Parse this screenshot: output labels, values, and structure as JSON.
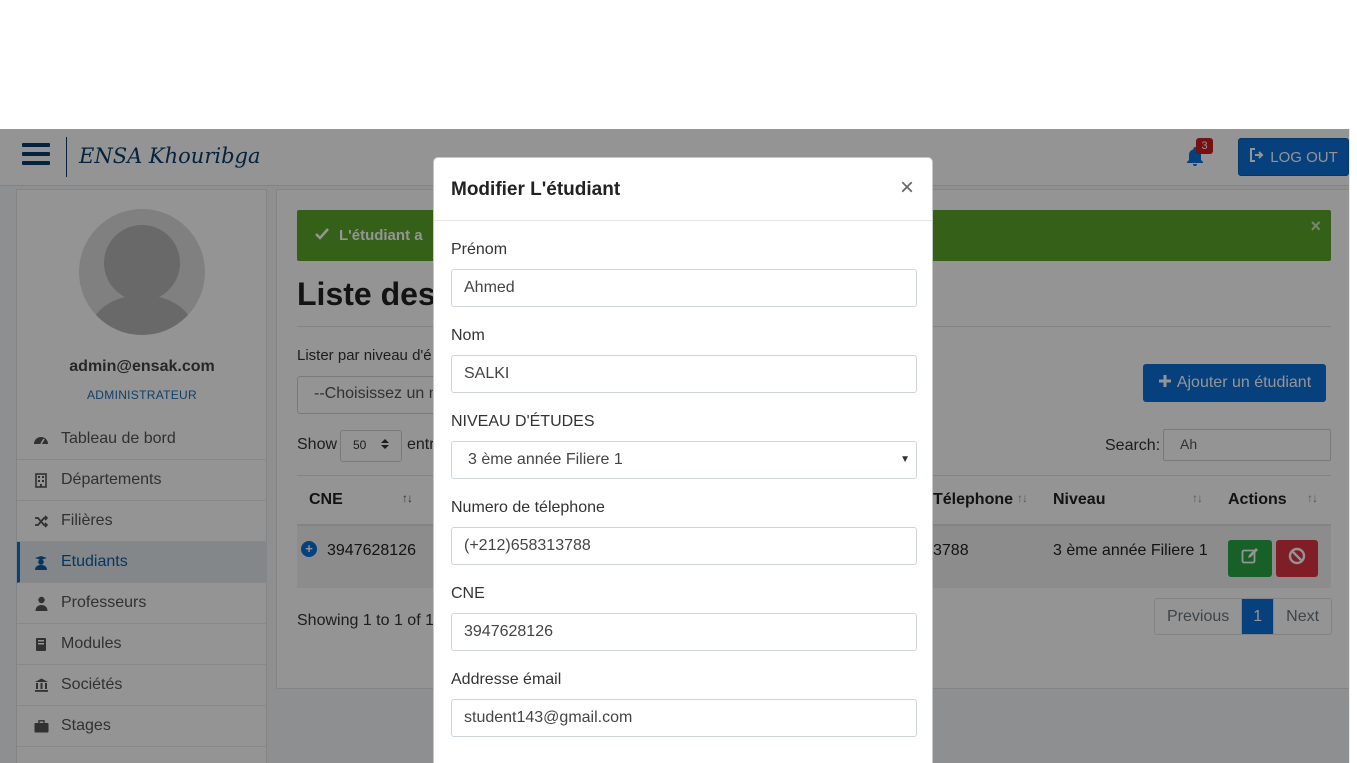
{
  "navbar": {
    "brand": "ENSA Khouribga",
    "notification_count": "3",
    "logout_label": "LOG OUT"
  },
  "sidebar": {
    "user_email": "admin@ensak.com",
    "user_role": "ADMINISTRATEUR",
    "items": [
      {
        "label": "Tableau de bord",
        "icon": "dashboard-icon"
      },
      {
        "label": "Départements",
        "icon": "building-icon"
      },
      {
        "label": "Filières",
        "icon": "shuffle-icon"
      },
      {
        "label": "Etudiants",
        "icon": "graduate-icon",
        "active": true
      },
      {
        "label": "Professeurs",
        "icon": "user-icon"
      },
      {
        "label": "Modules",
        "icon": "book-icon"
      },
      {
        "label": "Sociétés",
        "icon": "bank-icon"
      },
      {
        "label": "Stages",
        "icon": "briefcase-icon"
      }
    ]
  },
  "main": {
    "alert_text": "L'étudiant a",
    "alert_close": "×",
    "page_title": "Liste des é",
    "filter_label": "Lister par niveau d'é",
    "filter_placeholder": "--Choisissez un n",
    "add_button": "Ajouter un étudiant",
    "show_label": "Show",
    "show_value": "50",
    "entries_label": "entr",
    "search_label": "Search:",
    "search_value": "Ah",
    "columns": {
      "cne": "CNE",
      "telephone": "Télephone",
      "niveau": "Niveau",
      "actions": "Actions"
    },
    "rows": [
      {
        "cne": "3947628126",
        "telephone": "3788",
        "niveau": "3 ème année Filiere 1"
      }
    ],
    "showing_text": "Showing 1 to 1 of 1",
    "pagination": {
      "previous": "Previous",
      "current": "1",
      "next": "Next"
    }
  },
  "modal": {
    "title": "Modifier L'étudiant",
    "close": "×",
    "fields": {
      "prenom_label": "Prénom",
      "prenom_value": "Ahmed",
      "nom_label": "Nom",
      "nom_value": "SALKI",
      "niveau_label": "NIVEAU D'ÉTUDES",
      "niveau_value": "3 ème année Filiere 1",
      "telephone_label": "Numero de télephone",
      "telephone_value": "(+212)658313788",
      "cne_label": "CNE",
      "cne_value": "3947628126",
      "email_label": "Addresse émail",
      "email_value": "student143@gmail.com"
    }
  },
  "colors": {
    "primary": "#0b6fd8",
    "success": "#5aa52a",
    "danger": "#dc3545",
    "brand": "#0a3d6b"
  }
}
